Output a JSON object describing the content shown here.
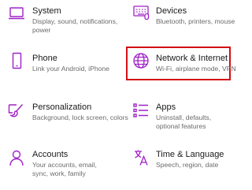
{
  "accent": "#a020c8",
  "highlight_color": "#d20f13",
  "tiles": [
    {
      "id": "system",
      "title": "System",
      "desc": "Display, sound, notifications, power",
      "icon": "laptop-icon"
    },
    {
      "id": "devices",
      "title": "Devices",
      "desc": "Bluetooth, printers, mouse",
      "icon": "keyboard-icon"
    },
    {
      "id": "phone",
      "title": "Phone",
      "desc": "Link your Android, iPhone",
      "icon": "phone-icon"
    },
    {
      "id": "network",
      "title": "Network & Internet",
      "desc": "Wi-Fi, airplane mode, VPN",
      "icon": "globe-icon"
    },
    {
      "id": "personalization",
      "title": "Personalization",
      "desc": "Background, lock screen, colors",
      "icon": "paintbrush-icon"
    },
    {
      "id": "apps",
      "title": "Apps",
      "desc": "Uninstall, defaults, optional features",
      "icon": "apps-list-icon"
    },
    {
      "id": "accounts",
      "title": "Accounts",
      "desc": "Your accounts, email, sync, work, family",
      "icon": "person-icon"
    },
    {
      "id": "time",
      "title": "Time & Language",
      "desc": "Speech, region, date",
      "icon": "language-icon"
    }
  ]
}
